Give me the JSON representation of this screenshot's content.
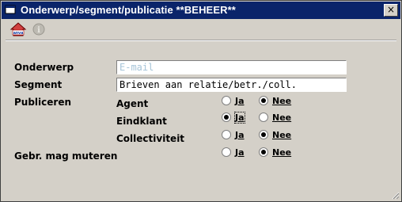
{
  "window": {
    "title": "Onderwerp/segment/publicatie **BEHEER**",
    "close_symbol": "×"
  },
  "toolbar": {
    "anva_label": "anva",
    "info_symbol": "i"
  },
  "form": {
    "onderwerp": {
      "label": "Onderwerp",
      "value": "E-mail"
    },
    "segment": {
      "label": "Segment",
      "value": "Brieven aan relatie/betr./coll."
    },
    "publiceren": {
      "label": "Publiceren"
    },
    "rows": [
      {
        "label": "Agent",
        "ja": "Ja",
        "nee": "Nee",
        "selected": "nee"
      },
      {
        "label": "Eindklant",
        "ja": "Ja",
        "nee": "Nee",
        "selected": "ja"
      },
      {
        "label": "Collectiviteit",
        "ja": "Ja",
        "nee": "Nee",
        "selected": "nee"
      }
    ],
    "gebr": {
      "label": "Gebr. mag muteren",
      "ja": "Ja",
      "nee": "Nee",
      "selected": "nee"
    }
  },
  "colors": {
    "titlebar": "#0a246a",
    "window_bg": "#d4d0c8",
    "placeholder_text": "#a6c4d8"
  }
}
